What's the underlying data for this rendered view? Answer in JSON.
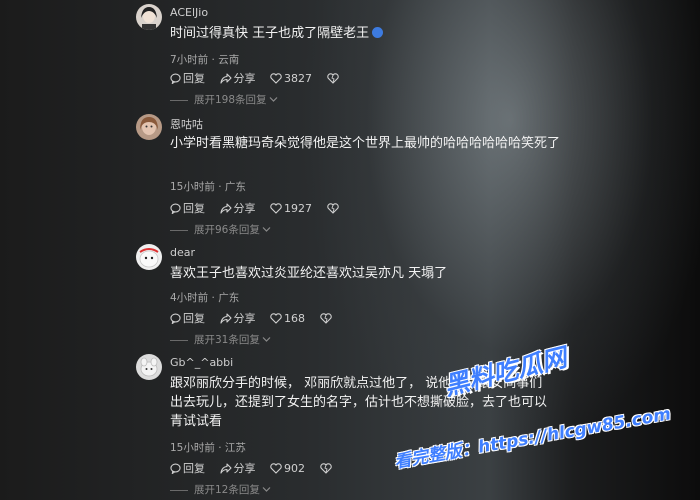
{
  "comments": [
    {
      "username": "ACElJio",
      "text": "时间过得真快 王子也成了隔壁老王",
      "meta": "7小时前 · 云南",
      "reply_label": "回复",
      "share_label": "分享",
      "likes": "3827",
      "expand_label": "展开198条回复"
    },
    {
      "username": "恩咕咕",
      "text": "小学时看黑糖玛奇朵觉得他是这个世界上最帅的哈哈哈哈哈哈笑死了",
      "meta": "15小时前 · 广东",
      "reply_label": "回复",
      "share_label": "分享",
      "likes": "1927",
      "expand_label": "展开96条回复"
    },
    {
      "username": "dear",
      "text": "喜欢王子也喜欢过炎亚纶还喜欢过吴亦凡 天塌了",
      "meta": "4小时前 · 广东",
      "reply_label": "回复",
      "share_label": "分享",
      "likes": "168",
      "expand_label": "展开31条回复"
    },
    {
      "username": "Gb^_^abbi",
      "text": "跟邓丽欣分手的时候， 邓丽欣就点过他了， 说他就爱跟女同事们出去玩儿，还提到了女生的名字，估计也不想撕破脸，去了也可以青试试看",
      "meta": "15小时前 · 江苏",
      "reply_label": "回复",
      "share_label": "分享",
      "likes": "902",
      "expand_label": "展开12条回复"
    }
  ],
  "watermark": {
    "brand": "黑料吃瓜网",
    "promo": "看完整版：https://hlcgw85.com"
  },
  "colors": {
    "accent": "#3f7fff",
    "text": "#f2f2f2",
    "muted": "#a9a9a9"
  }
}
